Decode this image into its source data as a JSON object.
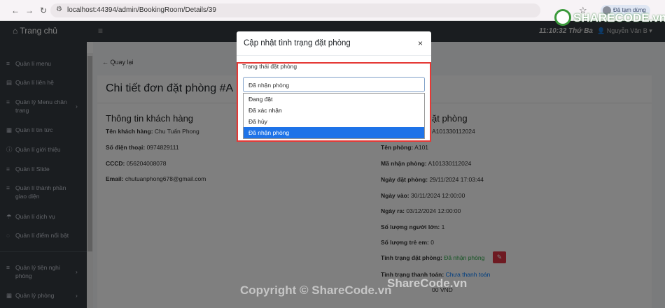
{
  "browser": {
    "url": "localhost:44394/admin/BookingRoom/Details/39",
    "paused_label": "Đã tạm dừng"
  },
  "topnav": {
    "brand": "Trang chủ",
    "clock": "11:10:32 Thứ Ba",
    "user": "Nguyễn Văn B"
  },
  "sidebar": {
    "items": [
      {
        "label": "Quản lí menu",
        "icon": "list-icon",
        "chevron": ""
      },
      {
        "label": "Quản lí liên hệ",
        "icon": "book-icon",
        "chevron": ""
      },
      {
        "label": "Quản lý Menu chân trang",
        "icon": "list-icon",
        "chevron": "›"
      },
      {
        "label": "Quản lí tin tức",
        "icon": "grid-icon",
        "chevron": ""
      },
      {
        "label": "Quản lí giới thiệu",
        "icon": "info-icon",
        "chevron": ""
      },
      {
        "label": "Quản lí Slide",
        "icon": "list-icon",
        "chevron": ""
      },
      {
        "label": "Quản lí thành phần giao diện",
        "icon": "list-icon",
        "chevron": ""
      },
      {
        "label": "Quản lí dịch vụ",
        "icon": "umbrella-icon",
        "chevron": ""
      },
      {
        "label": "Quản lí điểm nổi bật",
        "icon": "circle-icon",
        "chevron": ""
      },
      {
        "label": "Quản lý tiện nghi phòng",
        "icon": "list-icon",
        "chevron": "›"
      },
      {
        "label": "Quản lý phòng",
        "icon": "grid-icon",
        "chevron": "›"
      }
    ]
  },
  "content": {
    "back": "Quay lại",
    "title": "Chi tiết đơn đặt phòng #A",
    "customer": {
      "title": "Thông tin khách hàng",
      "name_label": "Tên khách hàng:",
      "name": "Chu Tuấn Phong",
      "phone_label": "Số điện thoại:",
      "phone": "0974829111",
      "cccd_label": "CCCD:",
      "cccd": "056204008078",
      "email_label": "Email:",
      "email": "chutuanphong678@gmail.com"
    },
    "booking": {
      "title_partial": "ặt phòng",
      "code_partial": "A101330112024",
      "room_label": "Tên phòng:",
      "room": "A101",
      "checkin_code_label": "Mã nhận phòng:",
      "checkin_code": "A101330112024",
      "booked_label": "Ngày đặt phòng:",
      "booked": "29/11/2024 17:03:44",
      "in_label": "Ngày vào:",
      "in": "30/11/2024 12:00:00",
      "out_label": "Ngày ra:",
      "out": "03/12/2024 12:00:00",
      "adults_label": "Số lượng người lớn:",
      "adults": "1",
      "children_label": "Số lượng trẻ em:",
      "children": "0",
      "status_label": "Tình trạng đặt phòng:",
      "status": "Đã nhận phòng",
      "payment_label": "Tình trạng thanh toán:",
      "payment": "Chưa thanh toán",
      "total_partial": "00 VND"
    }
  },
  "modal": {
    "title": "Cập nhật tình trạng đặt phòng",
    "close": "×",
    "field_label": "Trạng thái đặt phòng",
    "selected": "Đã nhận phòng",
    "options": [
      "Đang đặt",
      "Đã xác nhận",
      "Đã hủy",
      "Đã nhận phòng"
    ]
  },
  "watermark": {
    "logo": "SHARECODE.vn",
    "copyright": "Copyright © ShareCode.vn",
    "site": "ShareCode.vn"
  }
}
